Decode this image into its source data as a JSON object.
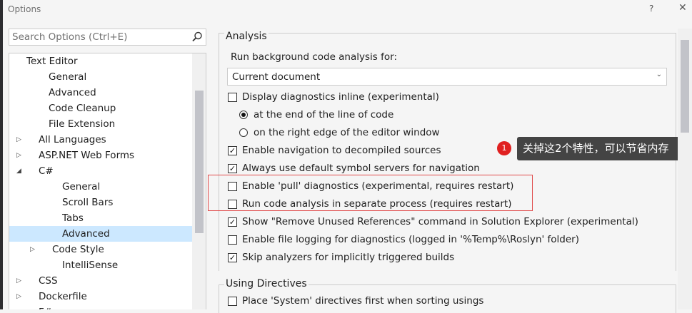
{
  "window": {
    "title": "Options",
    "help": "?",
    "close": "✕"
  },
  "search": {
    "placeholder": "Search Options (Ctrl+E)"
  },
  "tree": [
    {
      "label": "Text Editor",
      "expander": "◢"
    },
    {
      "label": "General",
      "expander": ""
    },
    {
      "label": "Advanced",
      "expander": ""
    },
    {
      "label": "Code Cleanup",
      "expander": ""
    },
    {
      "label": "File Extension",
      "expander": ""
    },
    {
      "label": "All Languages",
      "expander": "▷"
    },
    {
      "label": "ASP.NET Web Forms",
      "expander": "▷"
    },
    {
      "label": "C#",
      "expander": "◢"
    },
    {
      "label": "General",
      "expander": ""
    },
    {
      "label": "Scroll Bars",
      "expander": ""
    },
    {
      "label": "Tabs",
      "expander": ""
    },
    {
      "label": "Advanced",
      "expander": "",
      "selected": true
    },
    {
      "label": "Code Style",
      "expander": "▷"
    },
    {
      "label": "IntelliSense",
      "expander": ""
    },
    {
      "label": "CSS",
      "expander": "▷"
    },
    {
      "label": "Dockerfile",
      "expander": "▷"
    },
    {
      "label": "F#",
      "expander": "▷"
    }
  ],
  "analysis": {
    "title": "Analysis",
    "run_label": "Run background code analysis for:",
    "run_value": "Current document",
    "combo_arrow": "⌄",
    "options": [
      {
        "label": "Display diagnostics inline (experimental)",
        "kind": "checkbox",
        "checked": false
      },
      {
        "label": "at the end of the line of code",
        "kind": "radio",
        "checked": true
      },
      {
        "label": "on the right edge of the editor window",
        "kind": "radio",
        "checked": false
      },
      {
        "label": "Enable navigation to decompiled sources",
        "kind": "checkbox",
        "checked": true
      },
      {
        "label": "Always use default symbol servers for navigation",
        "kind": "checkbox",
        "checked": true
      },
      {
        "label": "Enable 'pull' diagnostics (experimental, requires restart)",
        "kind": "checkbox",
        "checked": false
      },
      {
        "label": "Run code analysis in separate process (requires restart)",
        "kind": "checkbox",
        "checked": false
      },
      {
        "label": "Show \"Remove Unused References\" command in Solution Explorer (experimental)",
        "kind": "checkbox",
        "checked": true
      },
      {
        "label": "Enable file logging for diagnostics (logged in '%Temp%\\Roslyn' folder)",
        "kind": "checkbox",
        "checked": false
      },
      {
        "label": "Skip analyzers for implicitly triggered builds",
        "kind": "checkbox",
        "checked": true
      }
    ]
  },
  "annotation": {
    "badge": "1",
    "text": "关掉这2个特性，可以节省内存",
    "box_color": "#e04a4a"
  },
  "using": {
    "title": "Using Directives",
    "options": [
      {
        "label": "Place 'System' directives first when sorting usings",
        "kind": "checkbox",
        "checked": false
      }
    ]
  },
  "colors": {
    "selection": "#cce8ff",
    "annotation_red": "#e02020",
    "callout_bg": "#444444"
  }
}
